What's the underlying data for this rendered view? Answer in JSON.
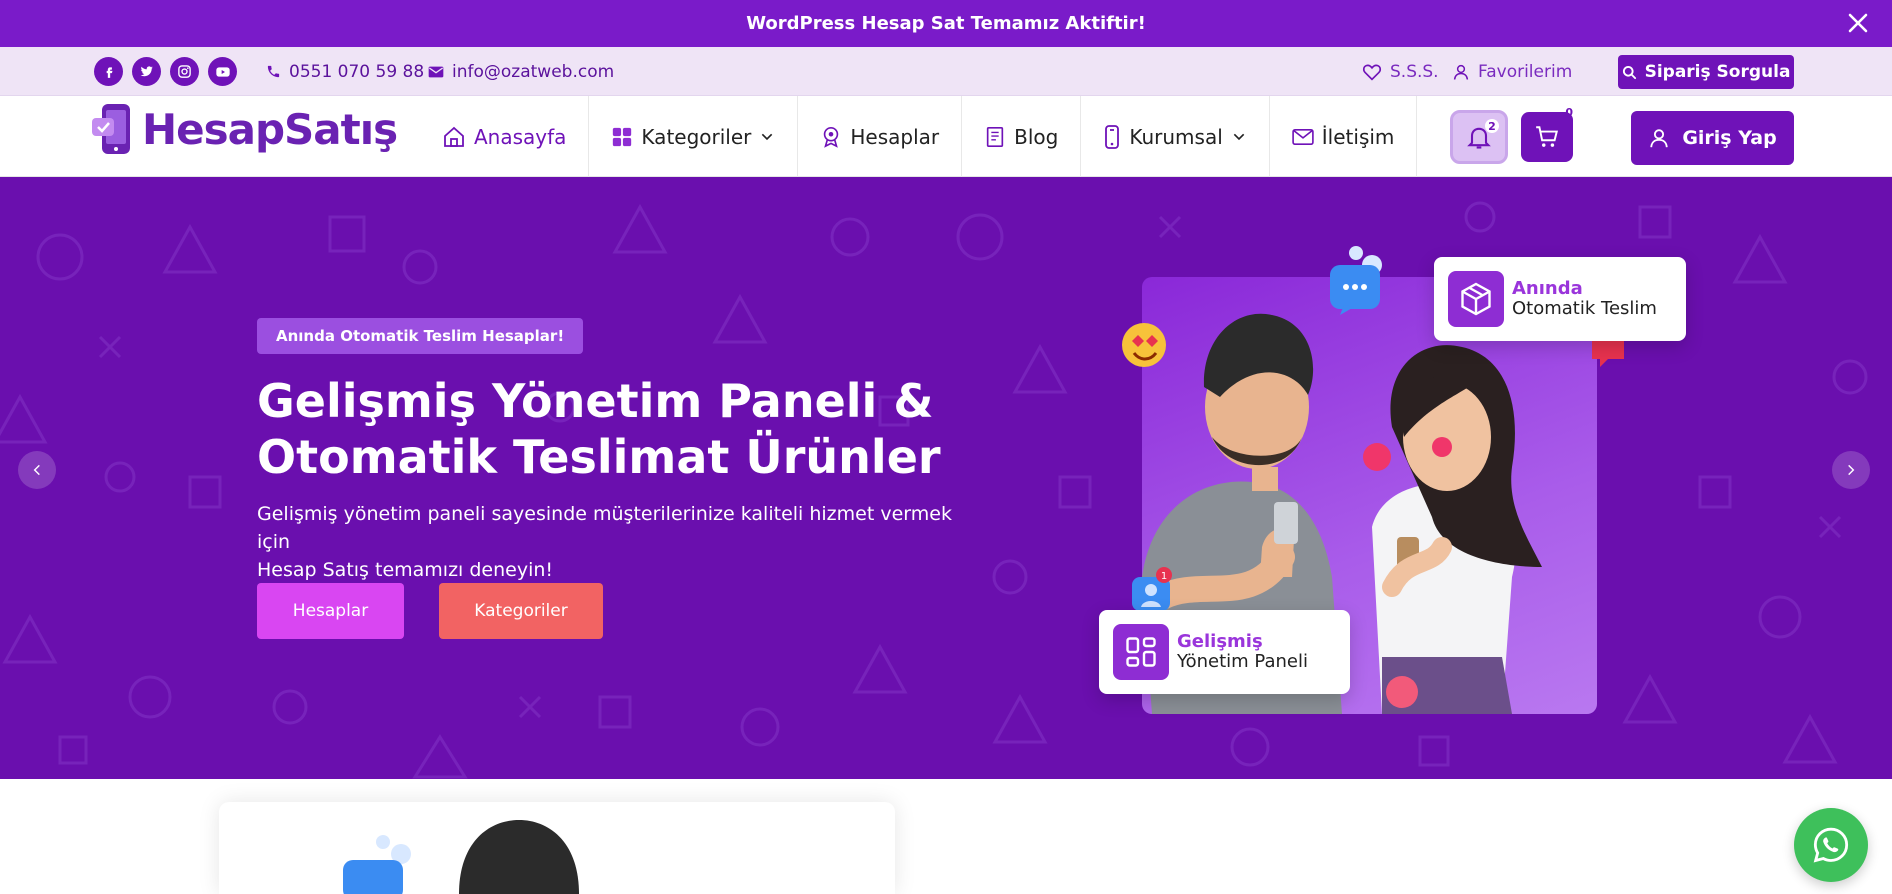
{
  "announcement": {
    "text": "WordPress Hesap Sat Temamız Aktiftir!"
  },
  "topbar": {
    "phone": "0551 070 59 88",
    "email": "info@ozatweb.com",
    "faq": "S.S.S.",
    "favorites": "Favorilerim",
    "order_query": "Sipariş Sorgula",
    "socials": [
      "facebook-icon",
      "twitter-icon",
      "instagram-icon",
      "youtube-icon"
    ]
  },
  "nav": {
    "logo": "HesapSatış",
    "items": [
      {
        "label": "Anasayfa",
        "icon": "home-icon"
      },
      {
        "label": "Kategoriler",
        "icon": "grid-icon"
      },
      {
        "label": "Hesaplar",
        "icon": "badge-icon"
      },
      {
        "label": "Blog",
        "icon": "book-icon"
      },
      {
        "label": "Kurumsal",
        "icon": "phone-icon"
      },
      {
        "label": "İletişim",
        "icon": "mail-icon"
      }
    ],
    "notifications_count": "2",
    "cart_count": "0",
    "login": "Giriş Yap"
  },
  "hero": {
    "badge": "Anında Otomatik Teslim Hesaplar!",
    "title_line1": "Gelişmiş Yönetim Paneli &",
    "title_line2": "Otomatik Teslimat Ürünler",
    "desc_line1": "Gelişmiş yönetim paneli sayesinde müşterilerinize kaliteli hizmet vermek için",
    "desc_line2": "Hesap Satış temamızı deneyin!",
    "btn_primary": "Hesaplar",
    "btn_secondary": "Kategoriler",
    "card1_top": "Anında",
    "card1_bottom": "Otomatik Teslim",
    "card2_top": "Gelişmiş",
    "card2_bottom": "Yönetim Paneli"
  },
  "colors": {
    "brand": "#6f12b8",
    "hero_bg": "#6a0fae",
    "accent_pink": "#d946f2",
    "accent_red": "#f26363",
    "whatsapp": "#3ec05b"
  }
}
